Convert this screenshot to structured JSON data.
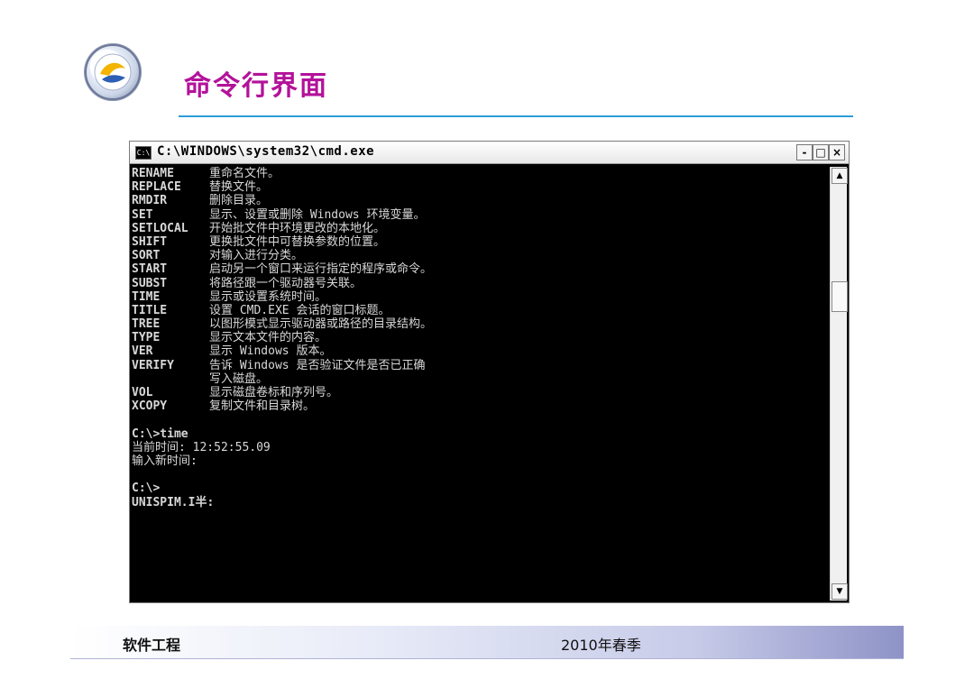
{
  "slide": {
    "title": "命令行界面",
    "footer_left": "软件工程",
    "footer_center": "2010年春季"
  },
  "window": {
    "title": "C:\\WINDOWS\\system32\\cmd.exe",
    "icon_label": "C:\\",
    "minimize": "-",
    "maximize": "□",
    "close": "×"
  },
  "console": {
    "commands": [
      {
        "name": "RENAME",
        "desc": "重命名文件。"
      },
      {
        "name": "REPLACE",
        "desc": "替换文件。"
      },
      {
        "name": "RMDIR",
        "desc": "删除目录。"
      },
      {
        "name": "SET",
        "desc": "显示、设置或删除 Windows 环境变量。"
      },
      {
        "name": "SETLOCAL",
        "desc": "开始批文件中环境更改的本地化。"
      },
      {
        "name": "SHIFT",
        "desc": "更换批文件中可替换参数的位置。"
      },
      {
        "name": "SORT",
        "desc": "对输入进行分类。"
      },
      {
        "name": "START",
        "desc": "启动另一个窗口来运行指定的程序或命令。"
      },
      {
        "name": "SUBST",
        "desc": "将路径跟一个驱动器号关联。"
      },
      {
        "name": "TIME",
        "desc": "显示或设置系统时间。"
      },
      {
        "name": "TITLE",
        "desc": "设置 CMD.EXE 会话的窗口标题。"
      },
      {
        "name": "TREE",
        "desc": "以图形模式显示驱动器或路径的目录结构。"
      },
      {
        "name": "TYPE",
        "desc": "显示文本文件的内容。"
      },
      {
        "name": "VER",
        "desc": "显示 Windows 版本。"
      },
      {
        "name": "VERIFY",
        "desc": "告诉 Windows 是否验证文件是否已正确"
      },
      {
        "name": "",
        "desc": "写入磁盘。"
      },
      {
        "name": "VOL",
        "desc": "显示磁盘卷标和序列号。"
      },
      {
        "name": "XCOPY",
        "desc": "复制文件和目录树。"
      }
    ],
    "lines_after": [
      "",
      "C:\\>time",
      "当前时间: 12:52:55.09",
      "输入新时间:",
      "",
      "C:\\>",
      "UNISPIM.I半:"
    ]
  },
  "scrollbar": {
    "up": "▲",
    "down": "▼"
  },
  "colors": {
    "title": "#b3129a",
    "rule": "#2d9dd8",
    "console_bg": "#000000",
    "console_text": "#d8d8d8"
  }
}
